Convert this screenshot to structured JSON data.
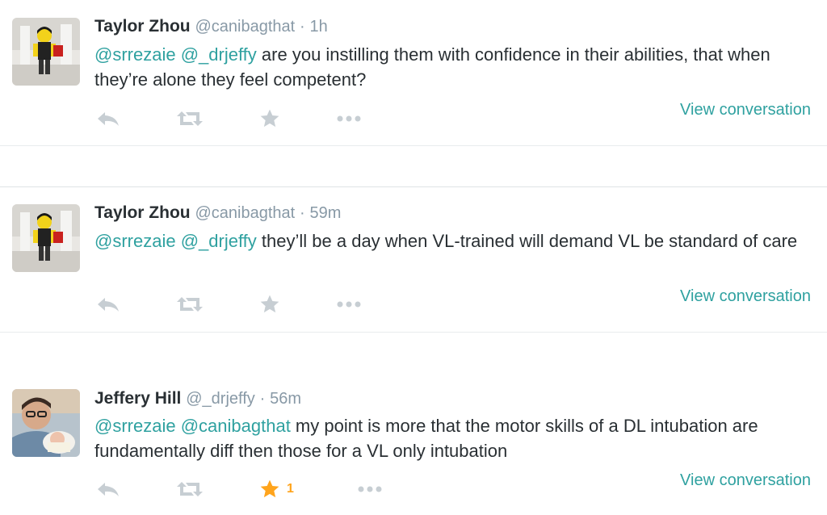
{
  "colors": {
    "mention": "#2fa1a0",
    "link": "#2fa1a0",
    "action_icon": "#c7ced3",
    "favorited": "#ffa41c",
    "muted_text": "#8899a6"
  },
  "tweets": [
    {
      "name": "Taylor Zhou",
      "handle": "@canibagthat",
      "separator": "·",
      "time": "1h",
      "mention1": "@srrezaie",
      "mention2": "@_drjeffy",
      "text": " are you instilling them with confidence in their abilities, that when they’re alone they feel competent?",
      "view_conversation": "View conversation",
      "favorited": false,
      "avatar_icon": "lego-figure-avatar"
    },
    {
      "name": "Taylor Zhou",
      "handle": "@canibagthat",
      "separator": "·",
      "time": "59m",
      "mention1": "@srrezaie",
      "mention2": "@_drjeffy",
      "text": " they’ll be a day when VL-trained will demand VL be standard of care",
      "view_conversation": "View conversation",
      "favorited": false,
      "avatar_icon": "lego-figure-avatar"
    },
    {
      "name": "Jeffery Hill",
      "handle": "@_drjeffy",
      "separator": "·",
      "time": "56m",
      "mention1": "@srrezaie",
      "mention2": "@canibagthat",
      "text": " my point is more that the motor skills of a DL intubation are fundamentally diff then those for a VL only intubation",
      "view_conversation": "View conversation",
      "favorited": true,
      "favorite_count": "1",
      "avatar_icon": "person-with-baby-avatar"
    }
  ],
  "icons": {
    "reply": "reply-icon",
    "retweet": "retweet-icon",
    "favorite": "star-icon",
    "more": "more-icon"
  }
}
